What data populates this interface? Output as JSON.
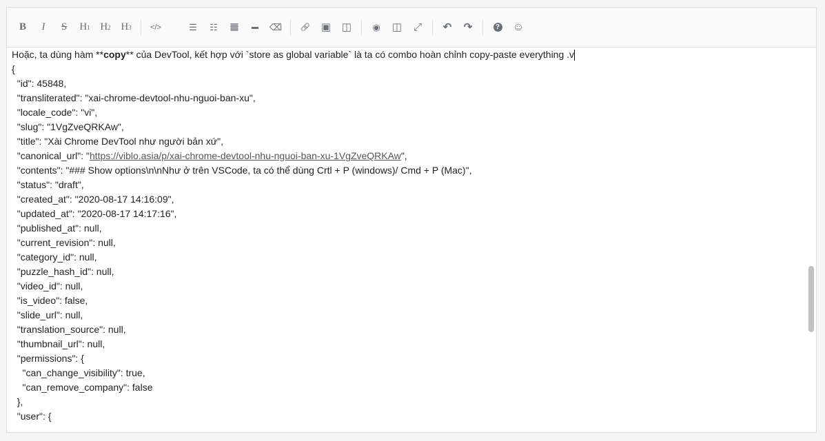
{
  "toolbar": {
    "bold": "B",
    "italic": "I",
    "strike": "S",
    "h1": "H",
    "h2": "H",
    "h3": "H",
    "h1sub": "1",
    "h2sub": "2",
    "h3sub": "3",
    "code": "</>",
    "ul": "☰",
    "ol": "☷",
    "table": "▦",
    "hr": "▬",
    "eraser": "⌫",
    "link": "🔗",
    "image": "▣",
    "embed": "◫",
    "preview": "◉",
    "side": "◫",
    "fullscreen": "⤢",
    "undo": "↶",
    "redo": "↷",
    "help": "?",
    "emoji": "☺"
  },
  "first_line": {
    "pre": "Hoặc, ta dùng hàm **",
    "bold": "copy",
    "post": "** của DevTool, kết hợp với `store as global variable` là ta có combo hoàn chỉnh copy-paste everything .v"
  },
  "lines": [
    "{",
    "  \"id\": 45848,",
    "  \"transliterated\": \"xai-chrome-devtool-nhu-nguoi-ban-xu\",",
    "  \"locale_code\": \"vi\",",
    "  \"slug\": \"1VgZveQRKAw\",",
    "  \"title\": \"Xài Chrome DevTool như người bản xứ\","
  ],
  "url_line": {
    "pre": "  \"canonical_url\": \"",
    "url": "https://viblo.asia/p/xai-chrome-devtool-nhu-nguoi-ban-xu-1VgZveQRKAw",
    "post": "\","
  },
  "lines2": [
    "  \"contents\": \"### Show options\\n\\nNhư ở trên VSCode, ta có thể dùng Crtl + P (windows)/ Cmd + P (Mac)\",",
    "  \"status\": \"draft\",",
    "  \"created_at\": \"2020-08-17 14:16:09\",",
    "  \"updated_at\": \"2020-08-17 14:17:16\",",
    "  \"published_at\": null,",
    "  \"current_revision\": null,",
    "  \"category_id\": null,",
    "  \"puzzle_hash_id\": null,",
    "  \"video_id\": null,",
    "  \"is_video\": false,",
    "  \"slide_url\": null,",
    "  \"translation_source\": null,",
    "  \"thumbnail_url\": null,",
    "  \"permissions\": {",
    "    \"can_change_visibility\": true,",
    "    \"can_remove_company\": false",
    "  },",
    "  \"user\": {"
  ]
}
